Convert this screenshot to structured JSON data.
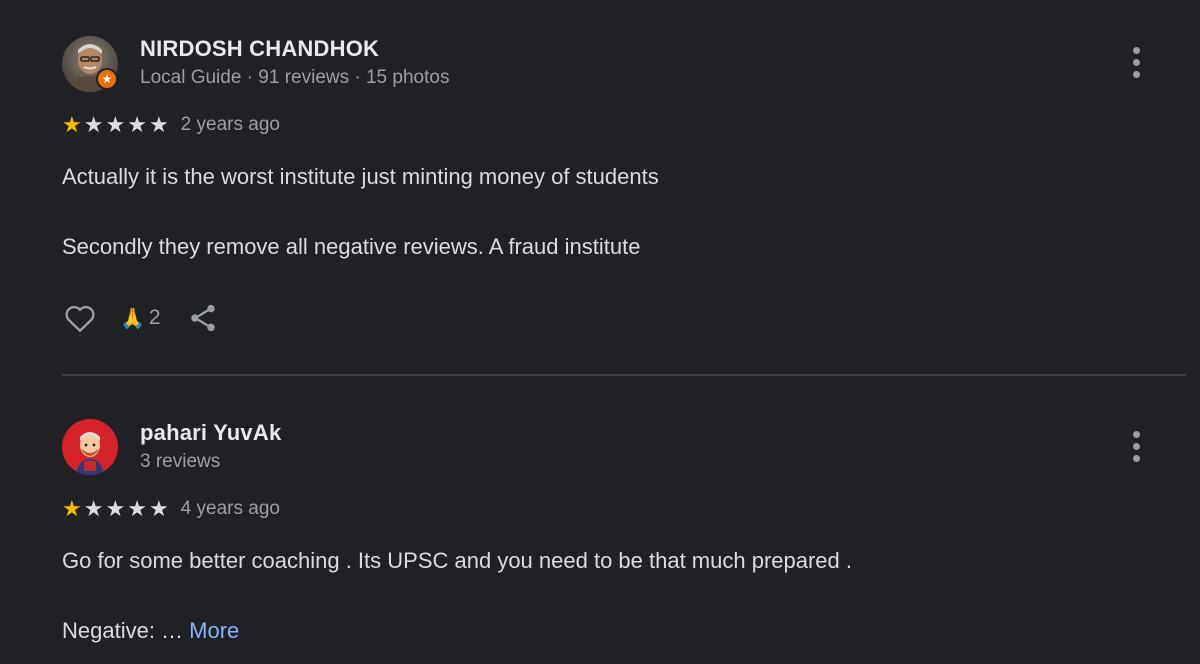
{
  "reviews": [
    {
      "author": "NIRDOSH CHANDHOK",
      "meta": "Local Guide · 91 reviews · 15 photos",
      "rating": 1,
      "rating_max": 5,
      "age": "2 years ago",
      "paragraphs": [
        "Actually it is the worst institute just minting money of students",
        "Secondly they remove all negative reviews. A fraud institute"
      ],
      "reaction_emoji": "🙏",
      "reaction_count": "2"
    },
    {
      "author": "pahari YuvAk",
      "meta": "3 reviews",
      "rating": 1,
      "rating_max": 5,
      "age": "4 years ago",
      "paragraphs": [
        "Go for some better coaching . Its UPSC and you need to be that much prepared .",
        "Negative: … "
      ],
      "more_label": "More"
    }
  ],
  "colors": {
    "background": "#202124",
    "star_filled": "#fbbc04",
    "star_empty": "#dadce0",
    "link": "#8ab4f8",
    "local_guide_badge": "#e8710a"
  },
  "icons": [
    "heart-icon",
    "share-icon",
    "more-vert-icon",
    "local-guide-badge-icon"
  ]
}
